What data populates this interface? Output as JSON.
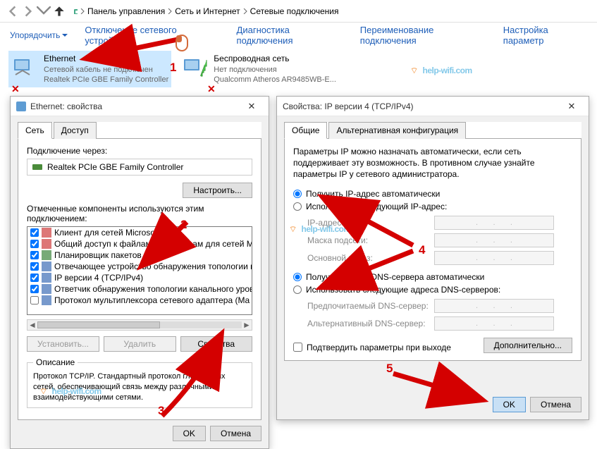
{
  "nav": {
    "breadcrumb": [
      "Панель управления",
      "Сеть и Интернет",
      "Сетевые подключения"
    ]
  },
  "toolbar": {
    "organize": "Упорядочить",
    "disable": "Отключение сетевого устройства",
    "diagnose": "Диагностика подключения",
    "rename": "Переименование подключения",
    "settings": "Настройка параметр"
  },
  "connections": [
    {
      "name": "Ethernet",
      "status": "Сетевой кабель не подключен",
      "device": "Realtek PCIe GBE Family Controller"
    },
    {
      "name": "Беспроводная сеть",
      "status": "Нет подключения",
      "device": "Qualcomm Atheros AR9485WB-E..."
    }
  ],
  "dlg1": {
    "title": "Ethernet: свойства",
    "tab_net": "Сеть",
    "tab_access": "Доступ",
    "connect_via": "Подключение через:",
    "adapter": "Realtek PCIe GBE Family Controller",
    "configure": "Настроить...",
    "components_label": "Отмеченные компоненты используются этим подключением:",
    "components": [
      "Клиент для сетей Microsoft",
      "Общий доступ к файлам и принтерам для сетей Mi",
      "Планировщик пакетов QoS",
      "Отвечающее устройство обнаружения топологии к",
      "IP версии 4 (TCP/IPv4)",
      "Ответчик обнаружения топологии канального уров",
      "Протокол мультиплексора сетевого адаптера (Ma"
    ],
    "install": "Установить...",
    "remove": "Удалить",
    "properties": "Свойства",
    "desc_title": "Описание",
    "desc_text": "Протокол TCP/IP. Стандартный протокол глобальных сетей, обеспечивающий связь между различными взаимодействующими сетями.",
    "ok": "OK",
    "cancel": "Отмена"
  },
  "dlg2": {
    "title": "Свойства: IP версии 4 (TCP/IPv4)",
    "tab_general": "Общие",
    "tab_alt": "Альтернативная конфигурация",
    "info": "Параметры IP можно назначать автоматически, если сеть поддерживает эту возможность. В противном случае узнайте параметры IP у сетевого администратора.",
    "ip_auto": "Получить IP-адрес автоматически",
    "ip_manual": "Использовать следующий IP-адрес:",
    "ip_addr": "IP-адрес:",
    "mask": "Маска подсети:",
    "gateway": "Основной шлюз:",
    "dns_auto": "Получить адрес DNS-сервера автоматически",
    "dns_manual": "Использовать следующие адреса DNS-серверов:",
    "dns_pref": "Предпочитаемый DNS-сервер:",
    "dns_alt": "Альтернативный DNS-сервер:",
    "confirm_exit": "Подтвердить параметры при выходе",
    "advanced": "Дополнительно...",
    "ok": "OK",
    "cancel": "Отмена",
    "dots": ".       .       ."
  },
  "annotations": {
    "n1": "1",
    "n2": "2",
    "n3": "3",
    "n4": "4",
    "n5": "5"
  },
  "watermark_text": "help-wifi.com"
}
